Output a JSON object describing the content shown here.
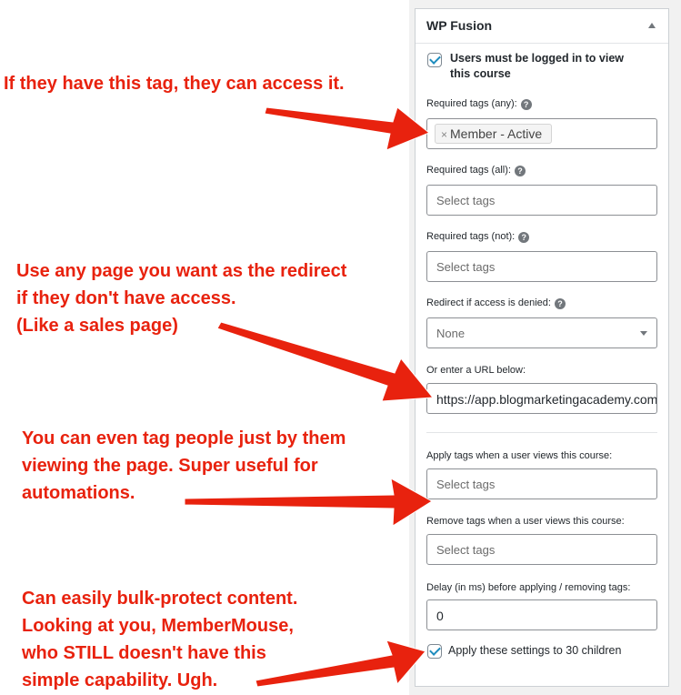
{
  "panel": {
    "title": "WP Fusion",
    "logged_in": {
      "label_line1": "Users must be logged in to view",
      "label_line2": "this course",
      "checked": true
    },
    "required_any": {
      "label": "Required tags (any):",
      "tags": [
        {
          "label": "Member - Active",
          "remove": "×"
        }
      ]
    },
    "required_all": {
      "label": "Required tags (all):",
      "placeholder": "Select tags"
    },
    "required_not": {
      "label": "Required tags (not):",
      "placeholder": "Select tags"
    },
    "redirect": {
      "label": "Redirect if access is denied:",
      "value": "None"
    },
    "redirect_url": {
      "label": "Or enter a URL below:",
      "value": "https://app.blogmarketingacademy.com"
    },
    "apply_tags": {
      "label": "Apply tags when a user views this course:",
      "placeholder": "Select tags"
    },
    "remove_tags": {
      "label": "Remove tags when a user views this course:",
      "placeholder": "Select tags"
    },
    "delay": {
      "label": "Delay (in ms) before applying / removing tags:",
      "value": "0"
    },
    "apply_children": {
      "label": "Apply these settings to 30 children",
      "checked": true
    },
    "help_glyph": "?"
  },
  "annotations": {
    "a1": [
      "If they have this tag, they can access it."
    ],
    "a2": [
      "Use any page you want as the redirect",
      "if they don't have access.",
      "(Like a sales page)"
    ],
    "a3": [
      "You can even tag people just by them",
      "viewing the page. Super useful for",
      "automations."
    ],
    "a4": [
      "Can easily bulk-protect content.",
      "Looking at you, MemberMouse,",
      "who STILL doesn't have this",
      "simple capability. Ugh."
    ]
  },
  "colors": {
    "annotation": "#e8220e",
    "checkbox": "#1e8cbe",
    "panel_border": "#ccd0d4"
  }
}
